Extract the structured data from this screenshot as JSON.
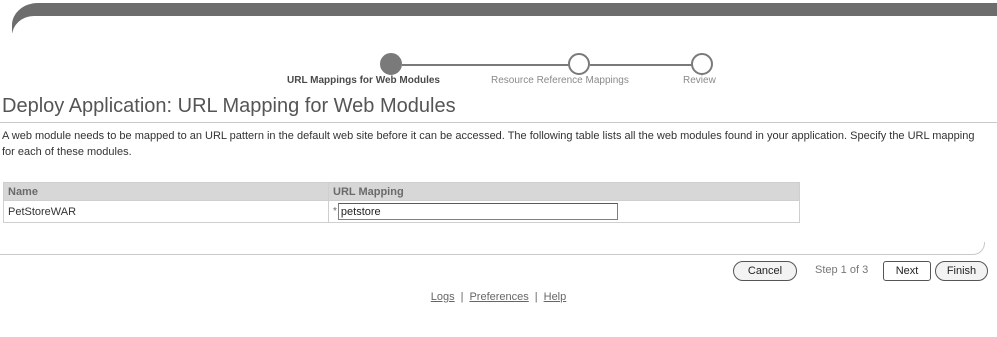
{
  "train": {
    "steps": [
      {
        "label": "URL Mappings for Web Modules",
        "state": "current"
      },
      {
        "label": "Resource Reference Mappings",
        "state": "pending"
      },
      {
        "label": "Review",
        "state": "pending"
      }
    ]
  },
  "page": {
    "title": "Deploy Application: URL Mapping for Web Modules",
    "instructions": "A web module needs to be mapped to an URL pattern in the default web site before it can be accessed. The following table lists all the web modules found in your application. Specify the URL mapping for each of these modules."
  },
  "table": {
    "columns": [
      "Name",
      "URL Mapping"
    ],
    "rows": [
      {
        "name": "PetStoreWAR",
        "url_mapping": "petstore",
        "required_marker": "*"
      }
    ]
  },
  "actions": {
    "cancel_label": "Cancel",
    "step_text": "Step 1 of 3",
    "next_label": "Next",
    "finish_label": "Finish"
  },
  "footer": {
    "links": [
      "Logs",
      "Preferences",
      "Help"
    ],
    "separator": "|"
  },
  "colors": {
    "band": "#6d6d6d",
    "train": "#7a7a7a",
    "header_bg": "#d7d7d7"
  }
}
